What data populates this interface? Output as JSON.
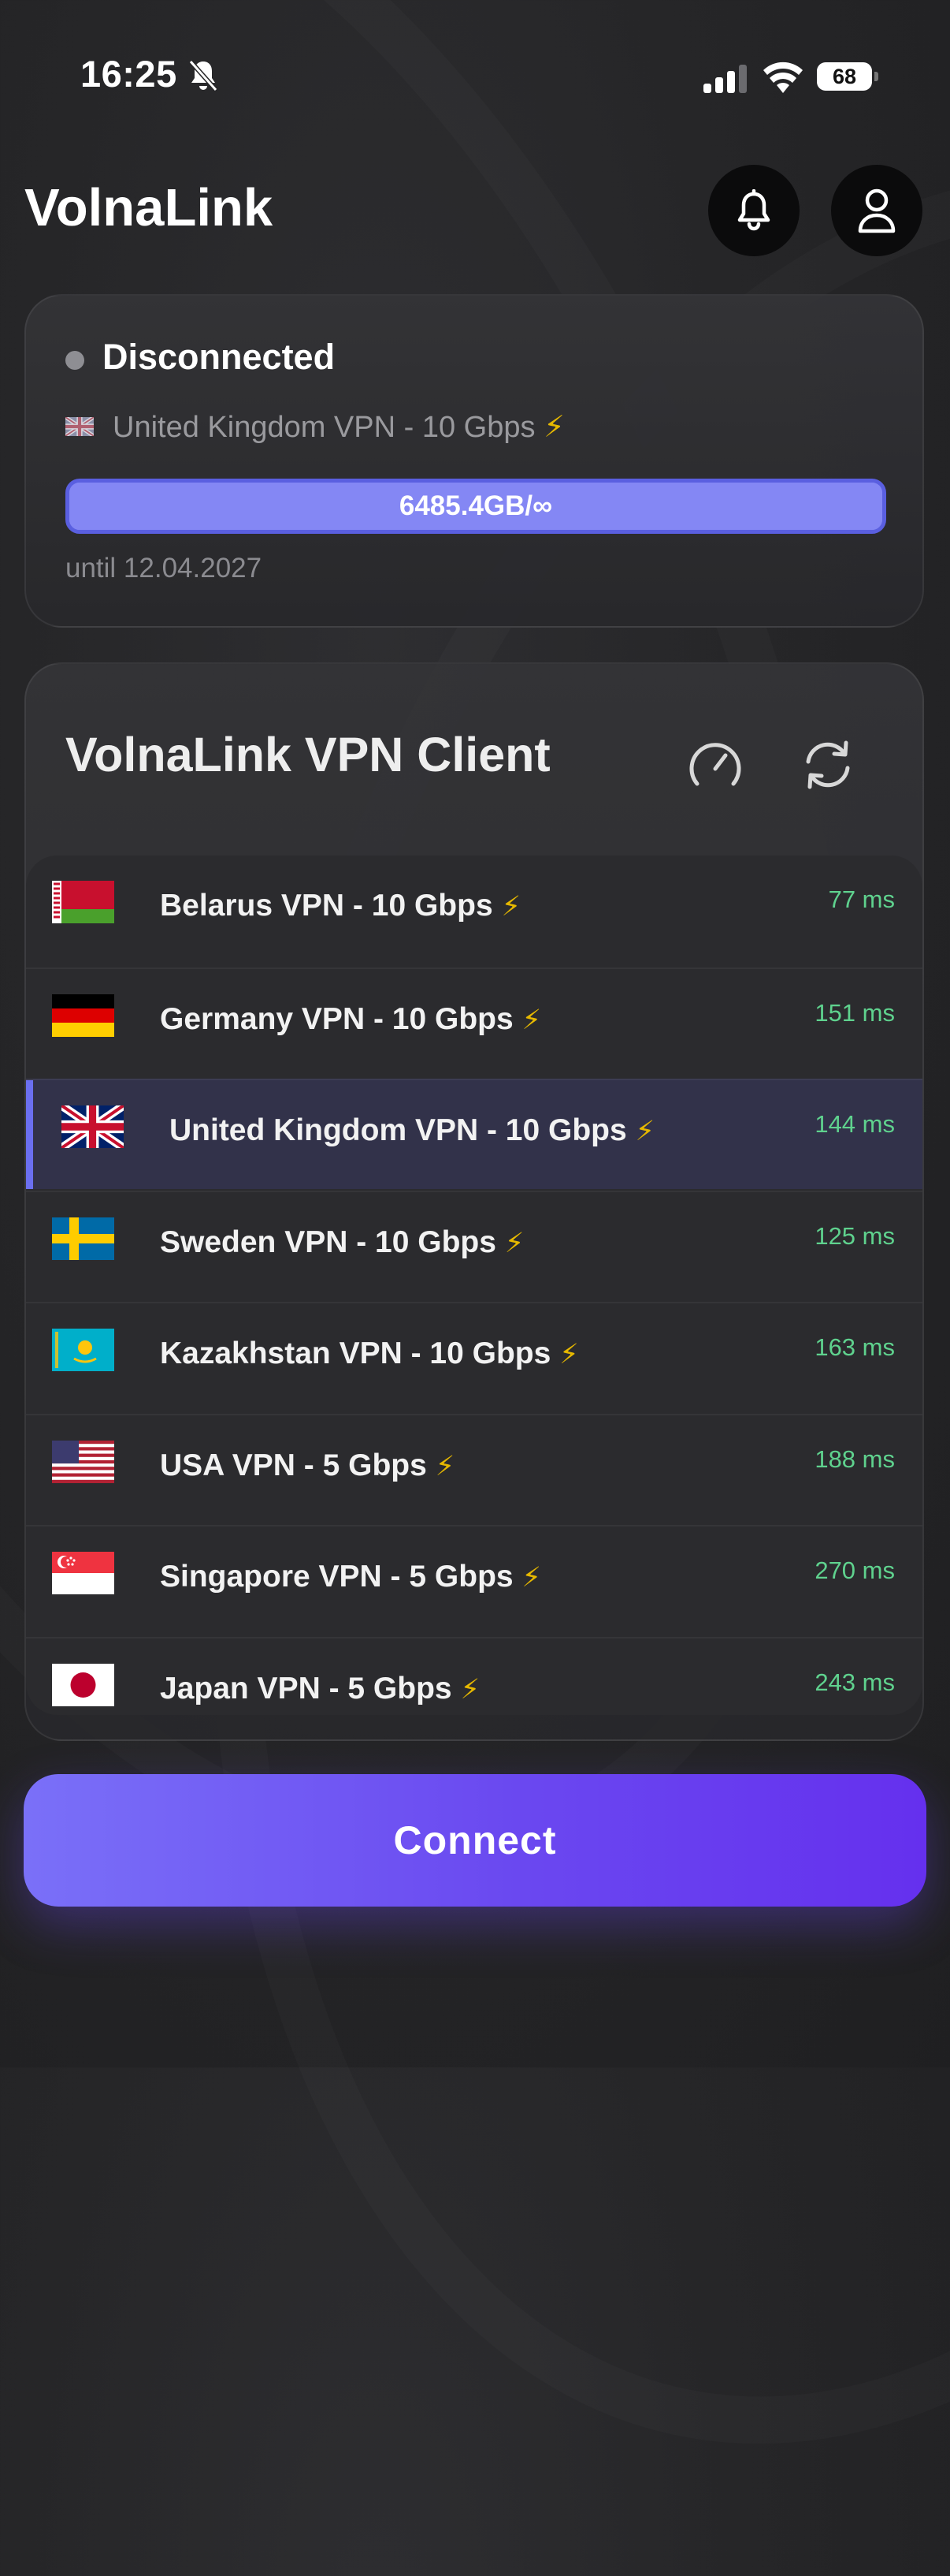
{
  "status_bar": {
    "time": "16:25",
    "battery": "68",
    "icons": [
      "bell-slash-icon",
      "cellular-signal-icon",
      "wifi-icon",
      "battery-icon"
    ]
  },
  "header": {
    "title": "VolnaLink",
    "icons": [
      "bell-icon",
      "user-icon"
    ]
  },
  "connection": {
    "status": "Disconnected",
    "server_name": "United Kingdom VPN - 10 Gbps",
    "bolt": "⚡",
    "traffic_label": "6485.4GB/∞",
    "traffic_fraction": 1.0,
    "until": "until 12.04.2027"
  },
  "client": {
    "title": "VolnaLink VPN Client",
    "icons": [
      "speedometer-icon",
      "refresh-icon"
    ],
    "bolt": "⚡",
    "servers": [
      {
        "name": "Belarus VPN - 10 Gbps",
        "ping": "77 ms",
        "flag": "belarus"
      },
      {
        "name": "Germany VPN - 10 Gbps",
        "ping": "151 ms",
        "flag": "germany"
      },
      {
        "name": "United Kingdom VPN - 10 Gbps",
        "ping": "144 ms",
        "flag": "uk",
        "selected": true
      },
      {
        "name": "Sweden VPN - 10 Gbps",
        "ping": "125 ms",
        "flag": "sweden"
      },
      {
        "name": "Kazakhstan VPN - 10 Gbps",
        "ping": "163 ms",
        "flag": "kazakhstan"
      },
      {
        "name": "USA VPN - 5 Gbps",
        "ping": "188 ms",
        "flag": "usa"
      },
      {
        "name": "Singapore VPN - 5 Gbps",
        "ping": "270 ms",
        "flag": "singapore"
      },
      {
        "name": "Japan VPN - 5 Gbps",
        "ping": "243 ms",
        "flag": "japan"
      }
    ]
  },
  "connect_button": {
    "label": "Connect"
  },
  "colors": {
    "accent": "#6b6ff0",
    "ping": "#5fd28e",
    "bolt": "#e6b800"
  }
}
